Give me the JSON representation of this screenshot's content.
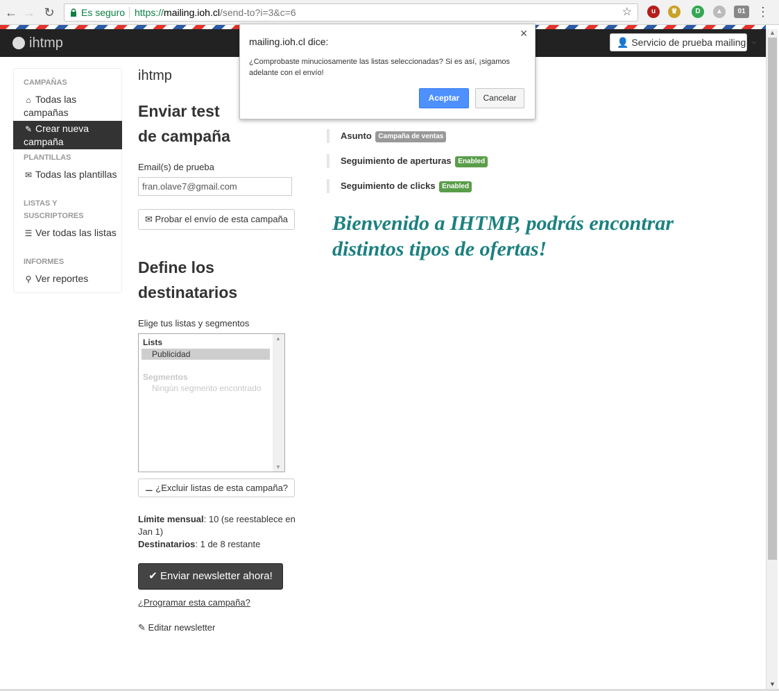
{
  "browser": {
    "back_icon": "arrow-left",
    "forward_icon": "arrow-right",
    "reload_icon": "reload",
    "secure_label": "Es seguro",
    "url_scheme": "https://",
    "url_host": "mailing.ioh.cl",
    "url_path": "/send-to?i=3&c=6",
    "extension_badge": "01"
  },
  "navbar": {
    "brand": "ihtmp",
    "user_menu": "Servicio de prueba mailing"
  },
  "sidebar": {
    "section_campaigns": "CAMPAÑAS",
    "all_campaigns": "Todas las campañas",
    "create_campaign": "Crear nueva campaña",
    "section_templates": "PLANTILLAS",
    "all_templates": "Todas las plantillas",
    "section_lists": "LISTAS Y SUSCRIPTORES",
    "all_lists": "Ver todas las listas",
    "section_reports": "INFORMES",
    "reports": "Ver reportes"
  },
  "main": {
    "app_title": "ihtmp",
    "test_heading": "Enviar test de campaña",
    "test_email_label": "Email(s) de prueba",
    "test_email_value": "fran.olave7@gmail.com",
    "test_button": "Probar el envío de esta campaña",
    "recipients_heading": "Define los destinatarios",
    "lists_label": "Elige tus listas y segmentos",
    "listbox": {
      "group_lists": "Lists",
      "selected_option": "Publicidad",
      "group_segments": "Segmentos",
      "no_segments": "Ningún segmento encontrado"
    },
    "exclude_button": "¿Excluir listas de esta campaña?",
    "monthly_limit_label": "Límite mensual",
    "monthly_limit_value": ": 10 (se reestablece en Jan 1)",
    "recipients_label": "Destinatarios",
    "recipients_value": ": 1 de 8 restante",
    "send_button": "Enviar newsletter ahora!",
    "schedule_link": "¿Programar esta campaña?",
    "edit_link": "Editar newsletter"
  },
  "details": {
    "subject_label": "Asunto",
    "subject_badge": "Campaña de ventas",
    "opens_label": "Seguimiento de aperturas",
    "opens_badge": "Enabled",
    "clicks_label": "Seguimiento de clicks",
    "clicks_badge": "Enabled",
    "welcome_text": "Bienvenido a IHTMP, podrás encontrar distintos tipos de ofertas!"
  },
  "dialog": {
    "title": "mailing.ioh.cl dice:",
    "message": "¿Comprobaste minuciosamente las listas seleccionadas? Si es así, ¡sigamos adelante con el envío!",
    "ok_label": "Aceptar",
    "cancel_label": "Cancelar"
  },
  "colors": {
    "accent_blue": "#4d90fe",
    "welcome_teal": "#1c8080",
    "badge_green": "#5a9d4a",
    "badge_grey": "#999999",
    "navbar_dark": "#222222"
  }
}
